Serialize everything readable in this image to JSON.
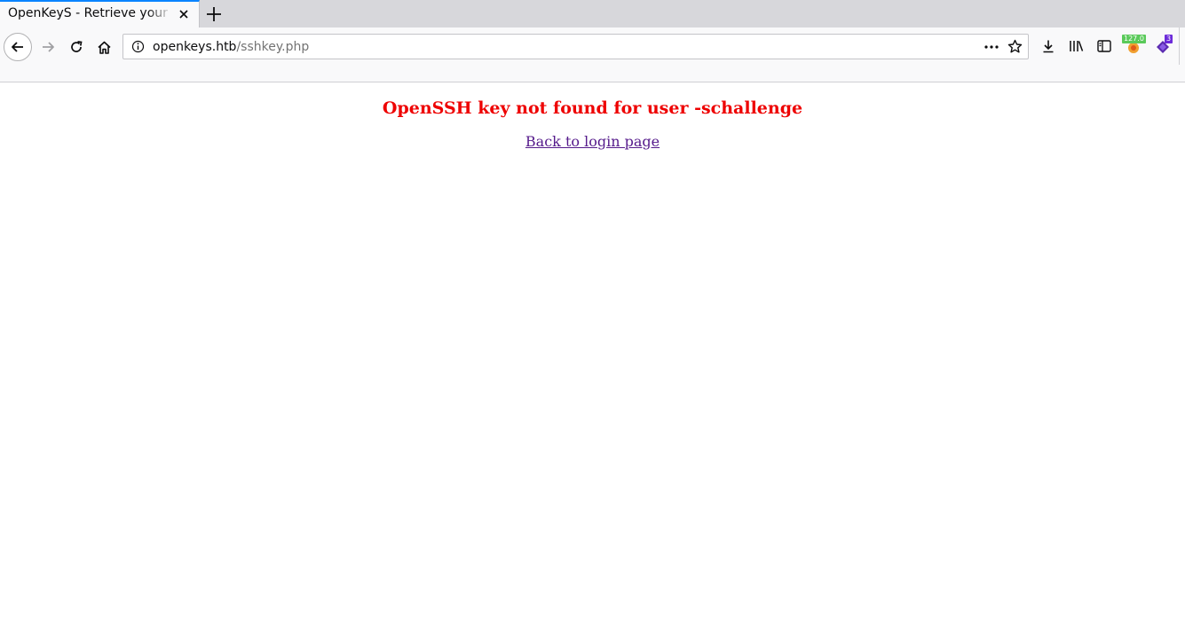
{
  "browser": {
    "tab": {
      "title": "OpenKeyS - Retrieve your OpenSSH Key"
    },
    "url": {
      "host": "openkeys.htb",
      "path": "/sshkey.php"
    },
    "toolbar": {
      "icons": [
        "back-icon",
        "forward-icon",
        "reload-icon",
        "home-icon",
        "info-icon",
        "page-actions-icon",
        "bookmark-star-icon",
        "download-icon",
        "library-icon",
        "sidebar-icon",
        "extension-icon",
        "extension-icon"
      ],
      "extension_badge_1": "127.0",
      "extension_badge_2": "3",
      "badge_colors": {
        "green": "#5aca5a",
        "purple": "#6c2bd9"
      }
    }
  },
  "page": {
    "error_message": "OpenSSH key not found for user -schallenge",
    "back_link": "Back to login page",
    "colors": {
      "error": "#ee0000",
      "visited_link": "#551a8b"
    }
  }
}
